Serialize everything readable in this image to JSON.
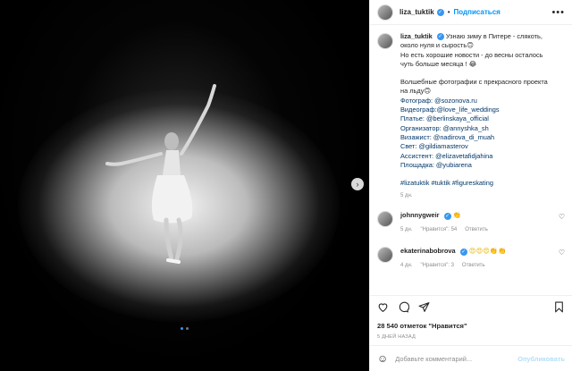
{
  "post": {
    "author": "liza_tuktik",
    "follow_label": "Подписаться",
    "separator": "•",
    "more": "•••",
    "caption_lines": [
      "Узнаю зиму в Питере - слякоть,",
      "около нуля и сырость🙃",
      "Но есть хорошие новости - до весны осталось",
      "чуть больше месяца ! 😂",
      "",
      "Волшебные фотографии с прекрасного проекта",
      "на льду🙃",
      "Фотограф: @sozonova.ru",
      "Видеограф:@love_life_weddings",
      "Платье: @berlinskaya_official",
      "Организатор: @annyshka_sh",
      "Визажист: @nadirova_di_muah",
      "Свет: @gildiamasterov",
      "Ассистент: @elizavetafidjahina",
      "Площадка: @yubiarena",
      "",
      "#lizatuktik #tuktik #figureskating"
    ],
    "caption_time": "5 дн."
  },
  "comments": [
    {
      "user": "johnnygweir",
      "text": "👏",
      "time": "5 дн.",
      "likes": "\"Нравится\": 54",
      "reply": "Ответить"
    },
    {
      "user": "ekaterinabobrova",
      "text": "😍😍😍👏👏",
      "time": "4 дн.",
      "likes": "\"Нравится\": 3",
      "reply": "Ответить"
    }
  ],
  "likes_line": "28 540 отметок \"Нравится\"",
  "date_line": "5 ДНЕЙ НАЗАД",
  "add_comment": {
    "placeholder": "Добавьте комментарий...",
    "publish": "Опубликовать"
  },
  "media": {
    "next_arrow": "›",
    "dots": 2,
    "active_dot": 0
  },
  "colors": {
    "link": "#0095f6",
    "verified": "#3897f0",
    "mention": "#00376b"
  }
}
